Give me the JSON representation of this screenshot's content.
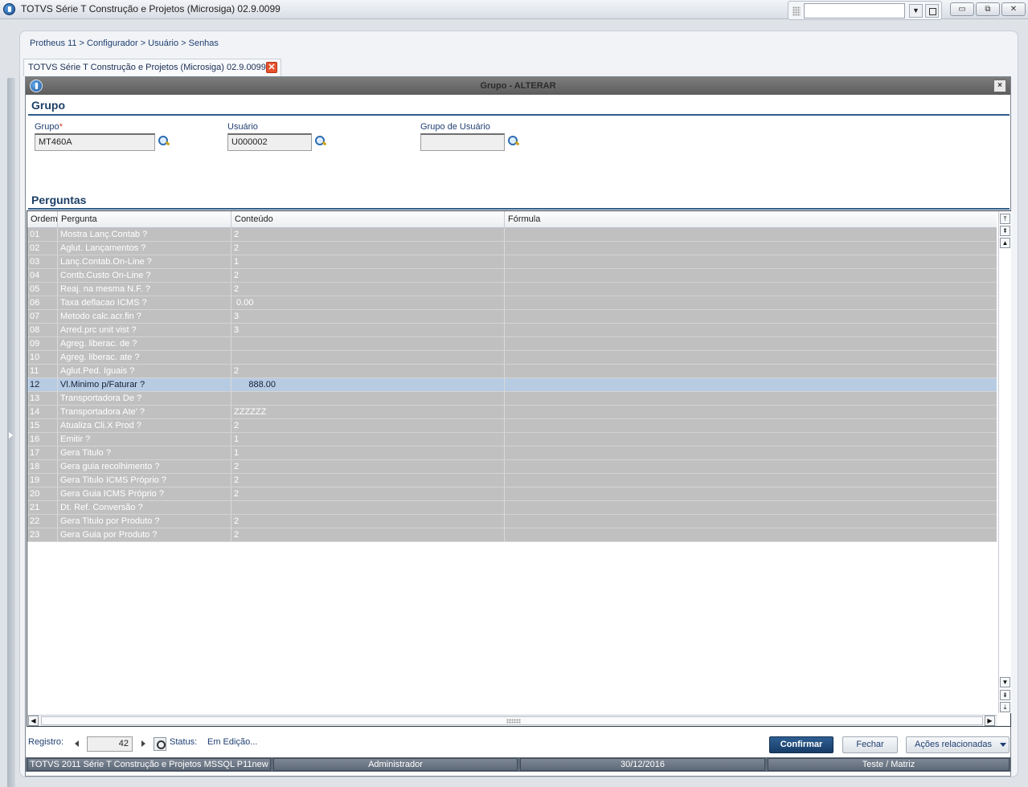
{
  "window": {
    "title": "TOTVS Série T Construção e Projetos (Microsiga) 02.9.0099",
    "search_value": "",
    "minimize_glyph": "▭",
    "restore_glyph": "⧉",
    "close_glyph": "✕",
    "dropdown_glyph": "▼"
  },
  "breadcrumb": "Protheus 11 > Configurador > Usuário > Senhas",
  "tab": {
    "label": "TOTVS Série T Construção e Projetos (Microsiga) 02.9.0099",
    "close_glyph": "✕"
  },
  "dialog": {
    "title": "Grupo - ALTERAR",
    "close_glyph": "×",
    "section_grupo": "Grupo",
    "section_perguntas": "Perguntas"
  },
  "fields": {
    "grupo_label": "Grupo",
    "grupo_required": "*",
    "grupo_value": "MT460A",
    "usuario_label": "Usuário",
    "usuario_value": "U000002",
    "grupo_usuario_label": "Grupo de Usuário",
    "grupo_usuario_value": ""
  },
  "grid": {
    "columns": [
      "Ordem",
      "Pergunta",
      "Conteúdo",
      "Fórmula"
    ],
    "rows": [
      [
        "01",
        "Mostra Lanç.Contab ?",
        "2",
        ""
      ],
      [
        "02",
        "Aglut. Lançamentos ?",
        "2",
        ""
      ],
      [
        "03",
        "Lanç.Contab.On-Line ?",
        "1",
        ""
      ],
      [
        "04",
        "Contb.Custo On-Line ?",
        "2",
        ""
      ],
      [
        "05",
        "Reaj. na mesma N.F. ?",
        "2",
        ""
      ],
      [
        "06",
        "Taxa deflacao ICMS ?",
        " 0.00",
        ""
      ],
      [
        "07",
        "Metodo calc.acr.fin ?",
        "3",
        ""
      ],
      [
        "08",
        "Arred.prc unit vist ?",
        "3",
        ""
      ],
      [
        "09",
        "Agreg. liberac. de ?",
        "",
        ""
      ],
      [
        "10",
        "Agreg. liberac. ate ?",
        "",
        ""
      ],
      [
        "11",
        "Aglut.Ped. Iguais ?",
        "2",
        ""
      ],
      [
        "12",
        "Vl.Minimo p/Faturar ?",
        "      888.00",
        ""
      ],
      [
        "13",
        "Transportadora De ?",
        "",
        ""
      ],
      [
        "14",
        "Transportadora Ate' ?",
        "ZZZZZZ",
        ""
      ],
      [
        "15",
        "Atualiza Cli.X Prod ?",
        "2",
        ""
      ],
      [
        "16",
        "Emitir ?",
        "1",
        ""
      ],
      [
        "17",
        "Gera Titulo ?",
        "1",
        ""
      ],
      [
        "18",
        "Gera guia recolhimento ?",
        "2",
        ""
      ],
      [
        "19",
        "Gera Titulo ICMS Próprio ?",
        "2",
        ""
      ],
      [
        "20",
        "Gera Guia ICMS Próprio ?",
        "2",
        ""
      ],
      [
        "21",
        "Dt. Ref. Conversão ?",
        "",
        ""
      ],
      [
        "22",
        "Gera Titulo por Produto ?",
        "2",
        ""
      ],
      [
        "23",
        "Gera Guia por Produto ?",
        "2",
        ""
      ]
    ],
    "selected_row": "12",
    "scroll_glyphs": {
      "top": "⤒",
      "page_up": "⇞",
      "up": "▲",
      "down": "▼",
      "page_down": "⇟",
      "bottom": "⤓",
      "left": "◀",
      "right": "▶"
    }
  },
  "footer": {
    "registro_label": "Registro:",
    "registro_value": "42",
    "status_label": "Status:",
    "status_value": "Em Edição...",
    "confirm_button": "Confirmar",
    "close_button": "Fechar",
    "actions_button": "Ações relacionadas"
  },
  "statusbar": {
    "product": "TOTVS 2011 Série T Construção e Projetos MSSQL P11new",
    "user": "Administrador",
    "date": "30/12/2016",
    "company": "Teste / Matriz"
  },
  "colors": {
    "accent": "#1d3f66",
    "row_bg": "#c0c0c0",
    "row_selected": "#b7cbe3",
    "required": "#d3382a"
  }
}
